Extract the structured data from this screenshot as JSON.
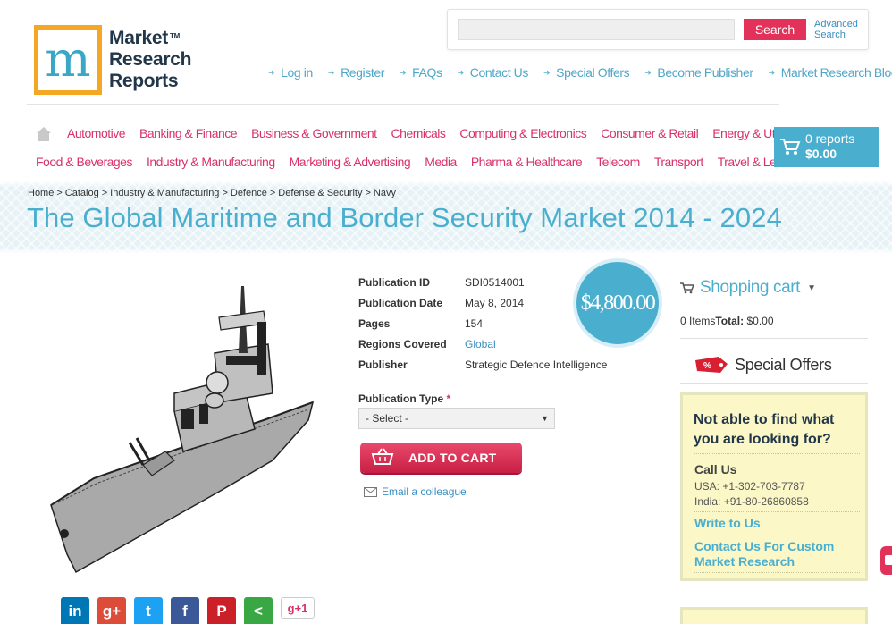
{
  "logo": {
    "lines": [
      "Market",
      "Research",
      "Reports"
    ],
    "tm": "TM"
  },
  "search": {
    "placeholder": "",
    "button": "Search",
    "advanced": "Advanced Search"
  },
  "toplinks": [
    "Log in",
    "Register",
    "FAQs",
    "Contact Us",
    "Special Offers",
    "Become Publisher",
    "Market Research Blog"
  ],
  "categories_row1": [
    "Automotive",
    "Banking & Finance",
    "Business & Government",
    "Chemicals",
    "Computing & Electronics",
    "Consumer & Retail",
    "Energy & Utilities"
  ],
  "categories_row2": [
    "Food & Beverages",
    "Industry & Manufacturing",
    "Marketing & Advertising",
    "Media",
    "Pharma & Healthcare",
    "Telecom",
    "Transport",
    "Travel & Leisure"
  ],
  "cart": {
    "reports": "0 reports",
    "amount": "$0.00"
  },
  "breadcrumb": [
    "Home",
    "Catalog",
    "Industry & Manufacturing",
    "Defence",
    "Defense & Security",
    "Navy"
  ],
  "title": "The Global Maritime and Border Security Market 2014 - 2024",
  "details": [
    {
      "label": "Publication ID",
      "value": "SDI0514001"
    },
    {
      "label": "Publication Date",
      "value": "May 8, 2014"
    },
    {
      "label": "Pages",
      "value": "154"
    },
    {
      "label": "Regions Covered",
      "value": "Global"
    },
    {
      "label": "Publisher",
      "value": "Strategic Defence Intelligence"
    }
  ],
  "price": "$4,800.00",
  "publication_type": {
    "label": "Publication Type",
    "required": "*",
    "selected": "- Select -"
  },
  "add_to_cart": "ADD TO CART",
  "email_colleague": "Email a colleague",
  "social": [
    {
      "icon": "linkedin-icon",
      "glyph": "in",
      "color": "#0077b5"
    },
    {
      "icon": "googleplus-icon",
      "glyph": "g+",
      "color": "#dd4b39"
    },
    {
      "icon": "twitter-icon",
      "glyph": "t",
      "color": "#1da1f2"
    },
    {
      "icon": "facebook-icon",
      "glyph": "f",
      "color": "#3b5998"
    },
    {
      "icon": "pinterest-icon",
      "glyph": "P",
      "color": "#cb2027"
    },
    {
      "icon": "share-icon",
      "glyph": "<",
      "color": "#3aa745"
    },
    {
      "icon": "googleplusone-icon",
      "glyph": "g+1",
      "color": "#ffffff"
    }
  ],
  "shopping_cart": {
    "title": "Shopping cart",
    "items": "0 Items",
    "total_label": "Total:",
    "total": "$0.00"
  },
  "special_offers": "Special Offers",
  "help": {
    "question": "Not able to find what you are looking for?",
    "call_us": "Call Us",
    "usa": "USA: +1-302-703-7787",
    "india": "India: +91-80-26860858",
    "write": "Write to Us",
    "custom": "Contact Us For Custom Market Research"
  },
  "colors": {
    "accent": "#4aafcf",
    "brand_pink": "#d9316a",
    "button_red": "#e3325a",
    "logo_orange": "#f5a623"
  }
}
